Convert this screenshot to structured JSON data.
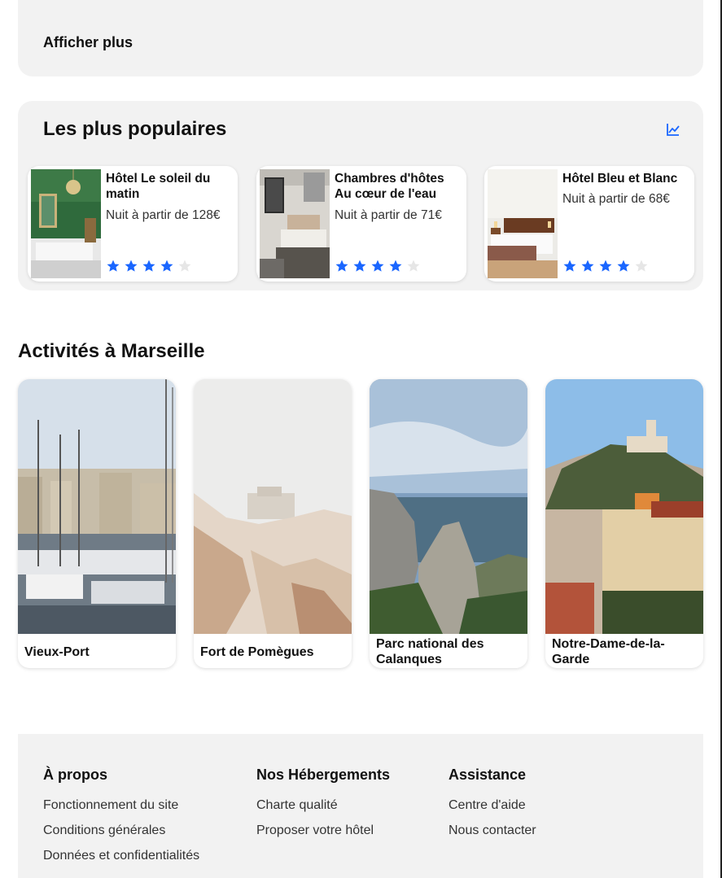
{
  "more": {
    "label": "Afficher plus"
  },
  "popular": {
    "title": "Les plus populaires",
    "icon": "trending-chart-icon",
    "accent": "#1a66ff",
    "hotels": [
      {
        "name": "Hôtel Le soleil du matin",
        "price": "Nuit à partir de 128€",
        "rating": 4,
        "max_rating": 5
      },
      {
        "name": "Chambres d'hôtes Au cœur de l'eau",
        "price": "Nuit à partir de 71€",
        "rating": 4,
        "max_rating": 5
      },
      {
        "name": "Hôtel Bleu et Blanc",
        "price": "Nuit à partir de 68€",
        "rating": 4,
        "max_rating": 5
      }
    ]
  },
  "activities": {
    "title": "Activités à Marseille",
    "items": [
      {
        "label": "Vieux-Port"
      },
      {
        "label": "Fort de Pomègues"
      },
      {
        "label": "Parc national des Calanques"
      },
      {
        "label": "Notre-Dame-de-la-Garde"
      }
    ]
  },
  "footer": {
    "columns": [
      {
        "heading": "À propos",
        "links": [
          "Fonctionnement du site",
          "Conditions générales",
          "Données et confidentialités"
        ]
      },
      {
        "heading": "Nos Hébergements",
        "links": [
          "Charte qualité",
          "Proposer votre hôtel"
        ]
      },
      {
        "heading": "Assistance",
        "links": [
          "Centre d'aide",
          "Nous contacter"
        ]
      }
    ]
  },
  "colors": {
    "panel": "#f2f2f2",
    "star_filled": "#1a66ff",
    "star_empty": "#e6e6e6"
  }
}
